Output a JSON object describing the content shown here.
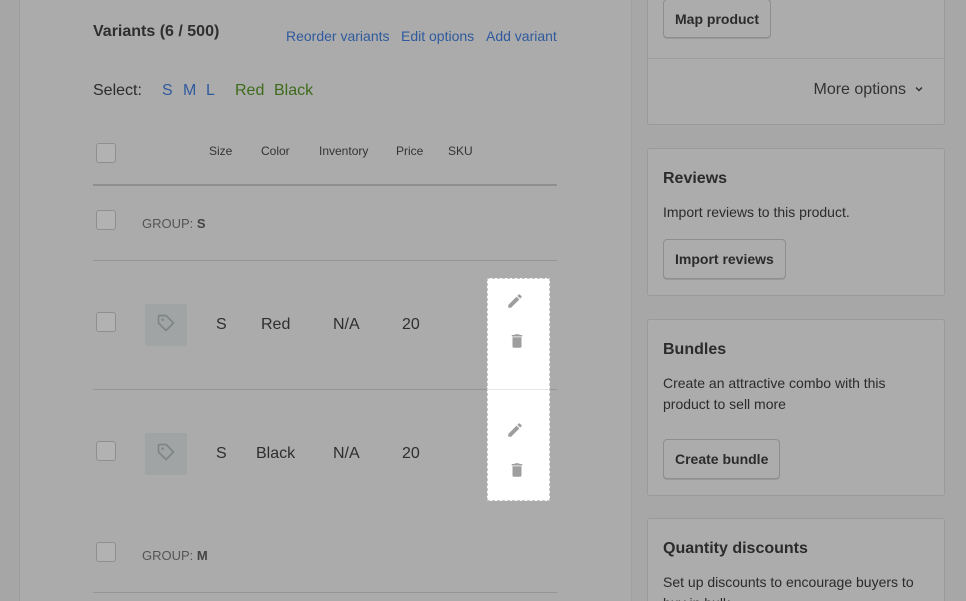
{
  "variants": {
    "title": "Variants (6 / 500)",
    "links": {
      "reorder": "Reorder variants",
      "edit_options": "Edit options",
      "add_variant": "Add variant"
    },
    "select_label": "Select:",
    "select_sizes": [
      "S",
      "M",
      "L"
    ],
    "select_colors": [
      "Red",
      "Black"
    ],
    "columns": {
      "size": "Size",
      "color": "Color",
      "inventory": "Inventory",
      "price": "Price",
      "sku": "SKU"
    },
    "group_prefix": "GROUP:",
    "groups": [
      {
        "name": "S"
      },
      {
        "name": "M"
      }
    ],
    "rows": [
      {
        "size": "S",
        "color": "Red",
        "inventory": "N/A",
        "price": "20",
        "sku": ""
      },
      {
        "size": "S",
        "color": "Black",
        "inventory": "N/A",
        "price": "20",
        "sku": ""
      }
    ]
  },
  "sidebar": {
    "map_product_button": "Map product",
    "more_options": "More options",
    "reviews": {
      "title": "Reviews",
      "text": "Import reviews to this product.",
      "button": "Import reviews"
    },
    "bundles": {
      "title": "Bundles",
      "text": "Create an attractive combo with this product to sell more",
      "button": "Create bundle"
    },
    "quantity_discounts": {
      "title": "Quantity discounts",
      "text": "Set up discounts to encourage buyers to buy in bulk"
    }
  },
  "icons": {
    "tag": "tag-icon",
    "edit": "pencil-icon",
    "delete": "trash-icon",
    "chevron": "chevron-down-icon"
  },
  "colors": {
    "link": "#2f5a9e",
    "color_option": "#3d6b1a",
    "overlay_bg": "#ababab"
  }
}
